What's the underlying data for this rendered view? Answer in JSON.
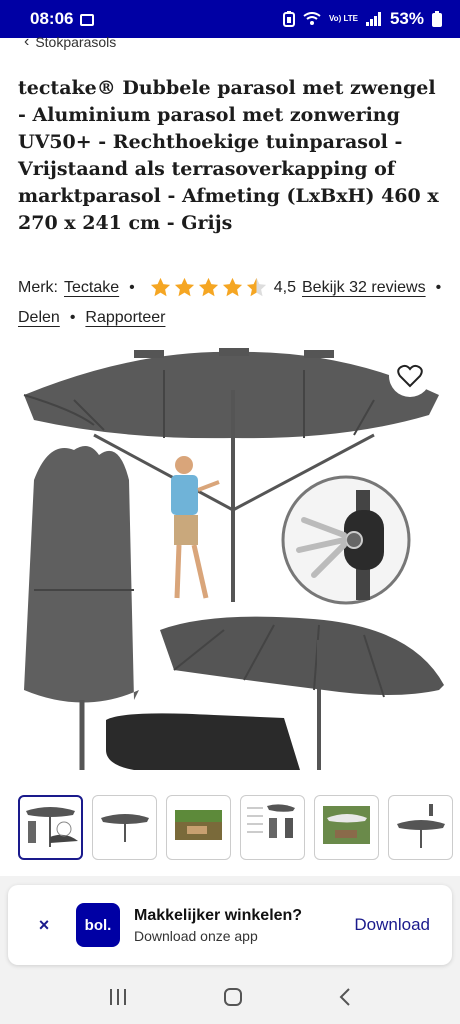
{
  "status": {
    "time": "08:06",
    "network": "Vo) LTE",
    "battery": "53%"
  },
  "breadcrumb": {
    "label": "Stokparasols"
  },
  "product": {
    "title": "tectake® Dubbele parasol met zwengel - Aluminium parasol met zonwering UV50+ - Rechthoekige tuinparasol - Vrijstaand als terrasoverkapping of marktparasol - Afmeting (LxBxH) 460 x 270 x 241 cm - Grijs",
    "brand_label": "Merk:",
    "brand": "Tectake",
    "rating": "4,5",
    "rating_value": 4.5,
    "rating_max": 5,
    "reviews_link": "Bekijk 32 reviews",
    "share": "Delen",
    "report": "Rapporteer"
  },
  "colors": {
    "brand_blue": "#0000a4",
    "star": "#f5a623",
    "link_blue": "#1a1a8c"
  },
  "thumbnails": [
    "thumb-1",
    "thumb-2",
    "thumb-3",
    "thumb-4",
    "thumb-5",
    "thumb-6"
  ],
  "app_banner": {
    "close": "×",
    "logo": "bol.",
    "title": "Makkelijker winkelen?",
    "subtitle": "Download onze app",
    "download": "Download"
  }
}
